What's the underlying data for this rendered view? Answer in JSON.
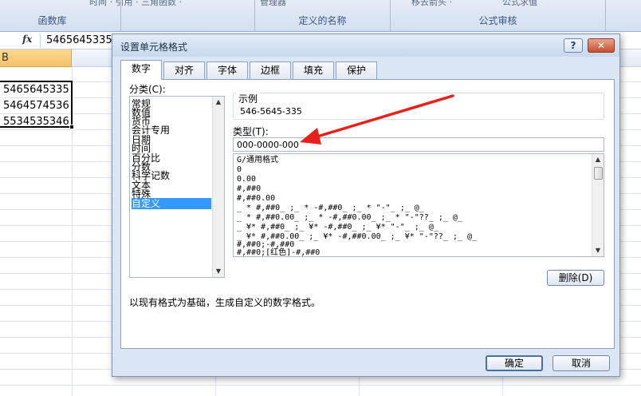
{
  "ribbon": {
    "groups": [
      {
        "top_text": "时间 · 引用 · 三角函数 ·",
        "label": "函数库"
      },
      {
        "top_text": "管理器",
        "label": "定义的名称"
      },
      {
        "top_text": "移去箭头 ·",
        "label": "公式审核"
      }
    ],
    "top_right": "公式求值"
  },
  "formula_bar": {
    "fx_label": "fx",
    "value": "5465645335"
  },
  "sheet": {
    "column_header": "B",
    "cells": [
      "5465645335",
      "5464574536",
      "5534535346"
    ]
  },
  "dialog": {
    "title": "设置单元格格式",
    "help_label": "?",
    "close_label": "✕",
    "tabs": [
      "数字",
      "对齐",
      "字体",
      "边框",
      "填充",
      "保护"
    ],
    "active_tab": "数字",
    "category_label": "分类(C):",
    "categories": [
      "常规",
      "数值",
      "货币",
      "会计专用",
      "日期",
      "时间",
      "百分比",
      "分数",
      "科学记数",
      "文本",
      "特殊",
      "自定义"
    ],
    "selected_category": "自定义",
    "sample_label": "示例",
    "sample_value": "546-5645-335",
    "type_label": "类型(T):",
    "type_value": "000-0000-000",
    "formats": [
      "G/通用格式",
      "0",
      "0.00",
      "#,##0",
      "#,##0.00",
      "_ * #,##0_ ;_ * -#,##0_ ;_ * \"-\"_ ;_ @_",
      "_ * #,##0.00_ ;_ * -#,##0.00_ ;_ * \"-\"??_ ;_ @_",
      "_ ¥* #,##0_ ;_ ¥* -#,##0_ ;_ ¥* \"-\"_ ;_ @_",
      "_ ¥* #,##0.00_ ;_ ¥* -#,##0.00_ ;_ ¥* \"-\"??_ ;_ @_",
      "#,##0;-#,##0",
      "#,##0;[红色]-#,##0"
    ],
    "delete_label": "删除(D)",
    "description": "以现有格式为基础，生成自定义的数字格式。",
    "ok_label": "确定",
    "cancel_label": "取消"
  },
  "colors": {
    "accent": "#3399ff",
    "arrow": "#e8201a",
    "column_header_selected": "#f6c26a"
  }
}
